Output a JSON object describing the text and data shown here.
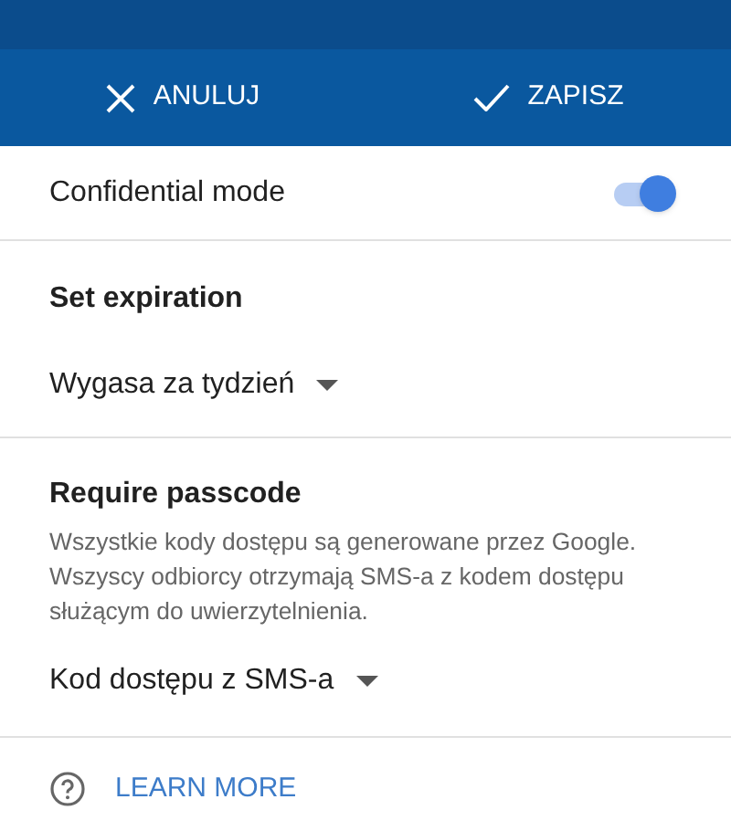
{
  "action_bar": {
    "buttons": [
      {
        "kind": "cancel",
        "label": "ANULUJ"
      },
      {
        "kind": "save",
        "label": "ZAPISZ"
      }
    ]
  },
  "confidential_mode": {
    "label": "Confidential mode",
    "on": true
  },
  "expiration": {
    "title": "Set expiration",
    "value": "Wygasa za tydzień"
  },
  "passcode": {
    "title": "Require passcode",
    "description": "Wszystkie kody dostępu są generowane przez Google. Wszyscy odbiorcy otrzymają SMS-a z kodem dostępu służącym do uwierzytelnienia.",
    "value": "Kod dostępu z SMS-a"
  },
  "learn_more": {
    "label": "LEARN MORE"
  }
}
